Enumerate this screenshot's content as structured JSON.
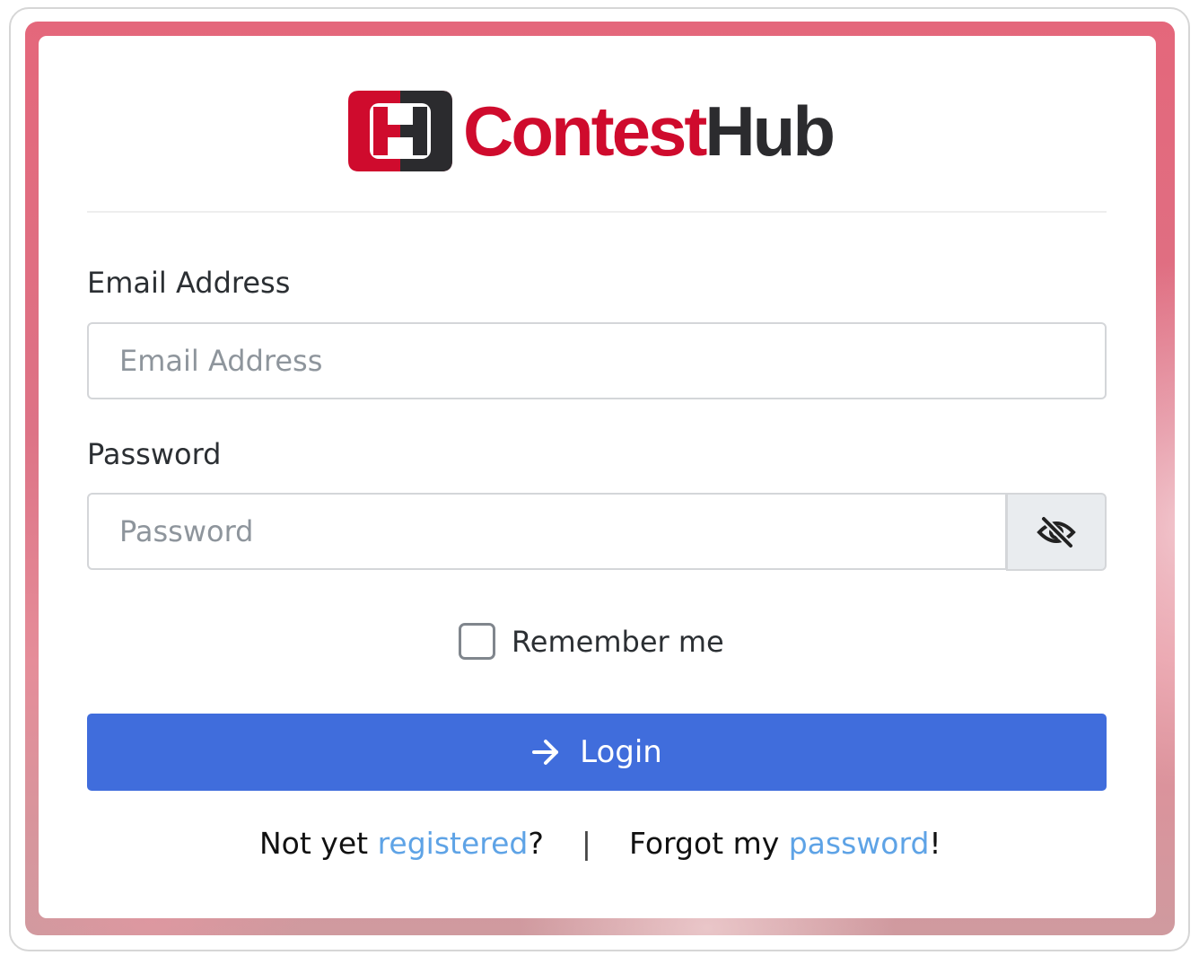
{
  "brand": {
    "name_part1": "Contest",
    "name_part2": "Hub",
    "mark_letter": "H",
    "colors": {
      "red": "#cf0b2d",
      "dark": "#2b2b2e"
    }
  },
  "form": {
    "email": {
      "label": "Email Address",
      "placeholder": "Email Address",
      "value": ""
    },
    "password": {
      "label": "Password",
      "placeholder": "Password",
      "value": "",
      "toggle_icon": "eye-slash-icon"
    },
    "remember_label": "Remember me",
    "remember_checked": false,
    "login_label": "Login",
    "login_icon": "arrow-right-icon",
    "login_color": "#406ddc"
  },
  "footer": {
    "not_yet": "Not yet ",
    "register_link": "registered",
    "question": "?",
    "separator": "|",
    "forgot": "Forgot my ",
    "password_link": "password",
    "exclaim": "!",
    "link_color": "#5ea3e6"
  }
}
